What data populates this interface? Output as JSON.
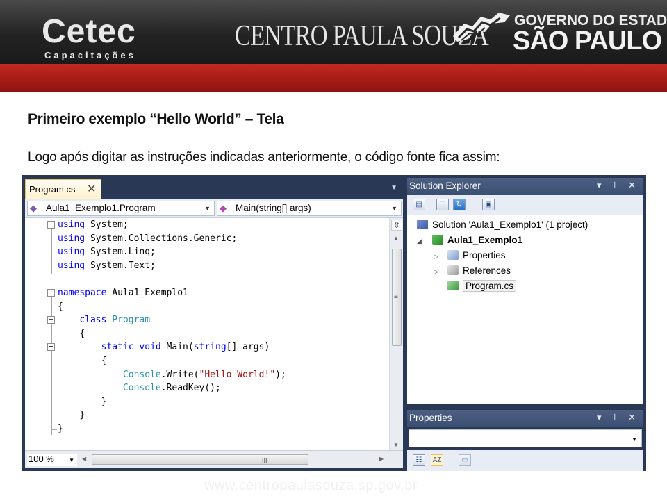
{
  "header": {
    "cetec_logo": "Cetec",
    "cetec_sub": "Capacitações",
    "cps_logo": "CENTRO PAULA SOUZA",
    "gov_line1": "GOVERNO DO ESTADO",
    "gov_line2": "SÃO PAULO",
    "colors": {
      "dark": "#232323",
      "red": "#a51b16"
    }
  },
  "slide": {
    "title": "Primeiro exemplo “Hello World” – Tela",
    "intro": "Logo após digitar as instruções indicadas anteriormente, o código fonte fica assim:",
    "footer_url": "www.centropaulasouza.sp.gov.br"
  },
  "editor": {
    "tab_label": "Program.cs",
    "tab_close": "✕",
    "class_combo": "Aula1_Exemplo1.Program",
    "member_combo": "Main(string[] args)",
    "zoom": "100 %",
    "code": {
      "l1_kw": "using",
      "l1_rest": " System;",
      "l2_kw": "using",
      "l2_rest": " System.Collections.Generic;",
      "l3_kw": "using",
      "l3_rest": " System.Linq;",
      "l4_kw": "using",
      "l4_rest": " System.Text;",
      "l6_kw": "namespace",
      "l6_rest": " Aula1_Exemplo1",
      "l7": "{",
      "l8_kw": "class",
      "l8_ty": "Program",
      "l9": "{",
      "l10_kw1": "static",
      "l10_kw2": "void",
      "l10_name": " Main(",
      "l10_kw3": "string",
      "l10_rest": "[] args)",
      "l11": "{",
      "l12_ty": "Console",
      "l12_mid": ".Write(",
      "l12_str": "\"Hello World!\"",
      "l12_end": ");",
      "l13_ty": "Console",
      "l13_rest": ".ReadKey();",
      "l14": "}",
      "l15": "}",
      "l16": "}"
    }
  },
  "solution_explorer": {
    "title": "Solution Explorer",
    "title_buttons": "▾ ⊥ ✕",
    "solution": "Solution 'Aula1_Exemplo1' (1 project)",
    "project": "Aula1_Exemplo1",
    "items": [
      "Properties",
      "References",
      "Program.cs"
    ]
  },
  "properties_panel": {
    "title": "Properties",
    "title_buttons": "▾ ⊥ ✕"
  }
}
